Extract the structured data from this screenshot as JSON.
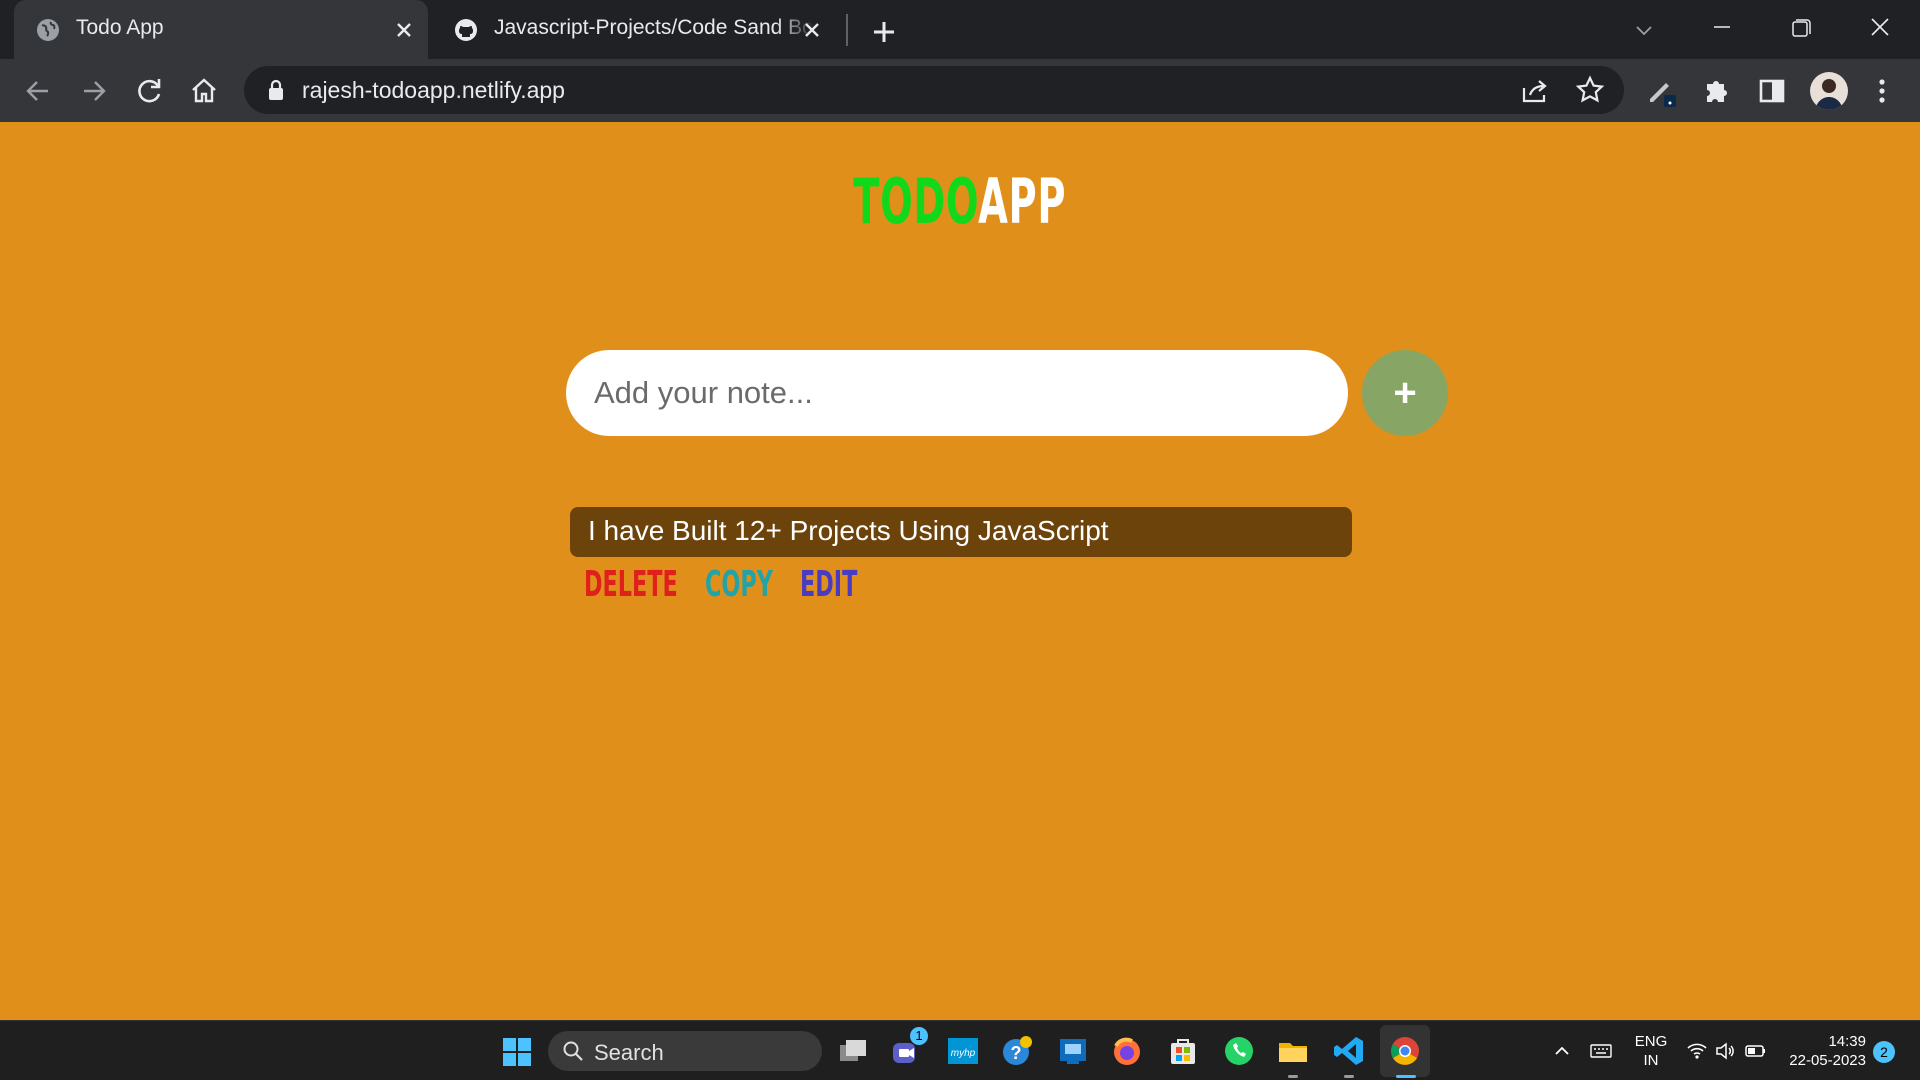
{
  "browser": {
    "tabs": [
      {
        "label": "Todo App",
        "active": true
      },
      {
        "label": "Javascript-Projects/Code Sand Box",
        "active": false
      }
    ],
    "url": "rajesh-todoapp.netlify.app"
  },
  "app": {
    "title_part1": "TODO",
    "title_part2": "APP",
    "input_placeholder": "Add your note...",
    "add_label": "+",
    "todos": [
      {
        "text": "I have Built 12+ Projects Using JavaScript"
      }
    ],
    "actions": {
      "delete": "DELETE",
      "copy": "COPY",
      "edit": "EDIT"
    }
  },
  "colors": {
    "page_bg": "#e0901a",
    "title_todo": "#12d81c",
    "title_app": "#ffffff",
    "add_button": "#87a564",
    "todo_card": "#6c440b",
    "delete": "#e0201a",
    "copy": "#22a3a8",
    "edit": "#4a3cc0"
  },
  "taskbar": {
    "search_label": "Search",
    "teams_badge": "1",
    "language": "ENG",
    "region": "IN",
    "time": "14:39",
    "date": "22-05-2023",
    "notification_count": "2",
    "icons": [
      "windows-start-icon",
      "search-icon",
      "task-view-icon",
      "teams-icon",
      "myhp-icon",
      "help-icon",
      "store-icon",
      "firefox-icon",
      "microsoft-store-icon",
      "whatsapp-icon",
      "file-explorer-icon",
      "vscode-icon",
      "chrome-icon"
    ]
  }
}
